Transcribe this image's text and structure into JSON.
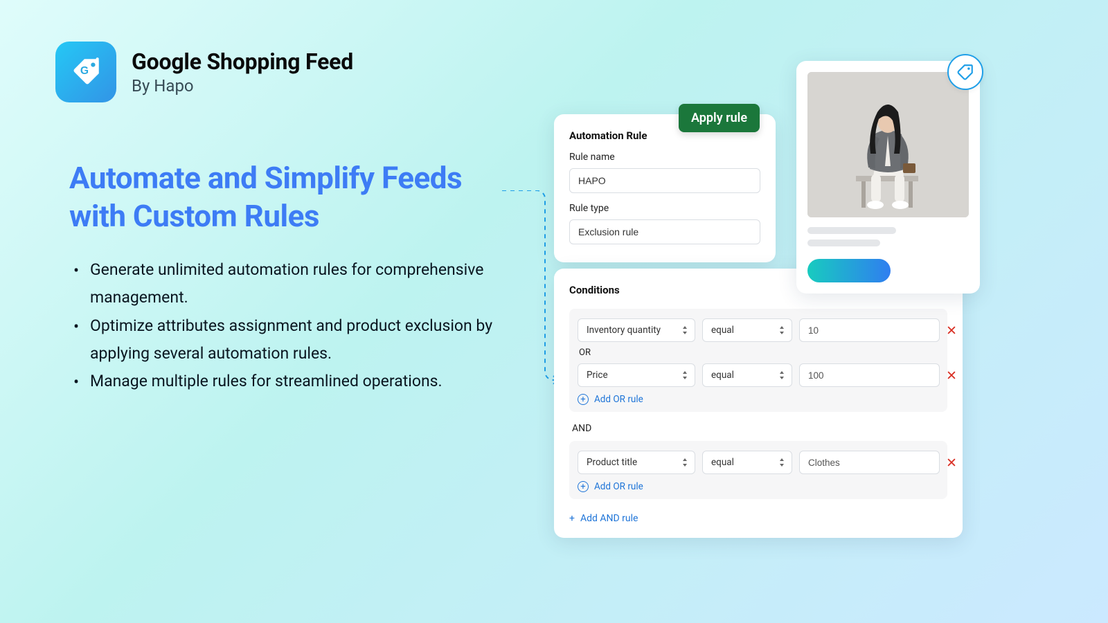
{
  "header": {
    "app_title": "Google Shopping Feed",
    "byline": "By Hapo"
  },
  "hero": {
    "headline": "Automate and Simplify Feeds with Custom Rules",
    "bullets": [
      "Generate unlimited automation rules for comprehensive management.",
      "Optimize attributes assignment and product exclusion by applying several automation rules.",
      "Manage multiple rules for streamlined operations."
    ]
  },
  "apply_button": "Apply rule",
  "automation_rule": {
    "title": "Automation Rule",
    "rule_name_label": "Rule name",
    "rule_name_value": "HAPO",
    "rule_type_label": "Rule type",
    "rule_type_value": "Exclusion rule"
  },
  "conditions": {
    "title": "Conditions",
    "or_label": "OR",
    "and_label": "AND",
    "add_or_label": "Add OR rule",
    "add_and_label": "Add AND rule",
    "group1": [
      {
        "field": "Inventory quantity",
        "operator": "equal",
        "value": "10"
      },
      {
        "field": "Price",
        "operator": "equal",
        "value": "100"
      }
    ],
    "group2": [
      {
        "field": "Product title",
        "operator": "equal",
        "value": "Clothes"
      }
    ]
  },
  "colors": {
    "accent_blue": "#3d7cf5",
    "button_green": "#1b773b",
    "link_blue": "#1f75d8",
    "danger_red": "#d93025"
  }
}
